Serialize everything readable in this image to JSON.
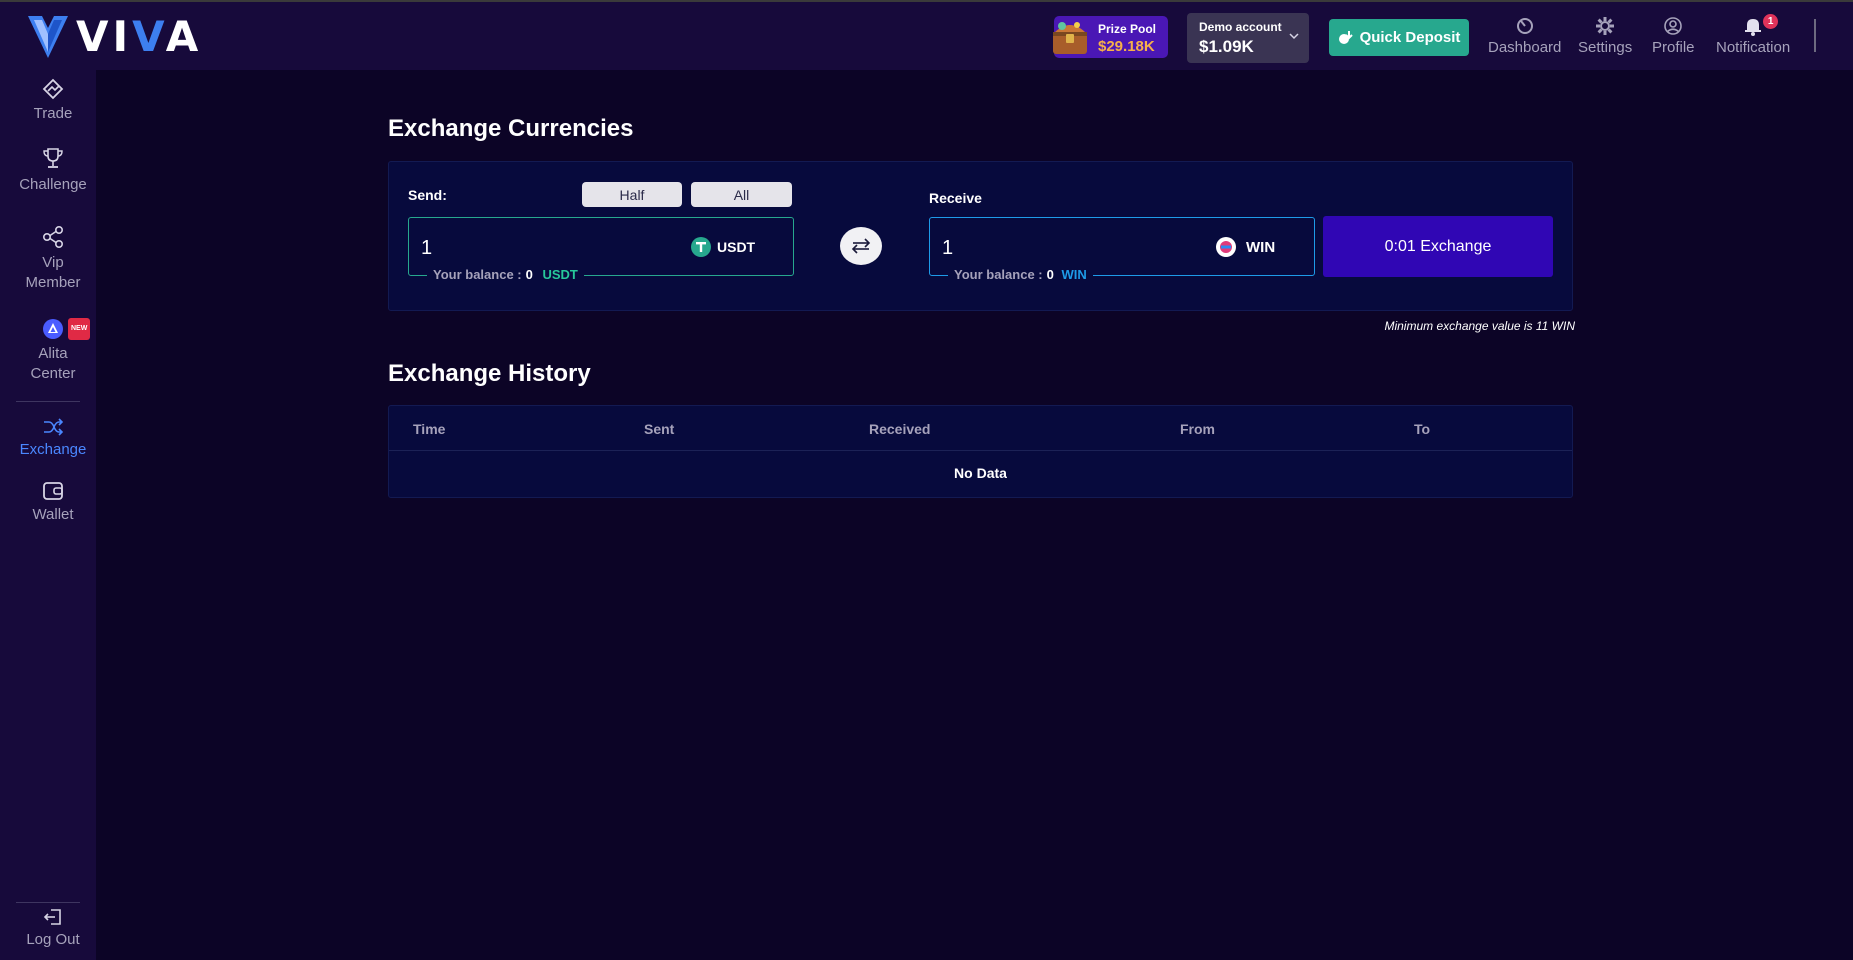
{
  "brand": {
    "name_prefix": "VI",
    "name_accent": "V",
    "name_suffix": "A"
  },
  "header": {
    "prize_pool": {
      "label": "Prize Pool",
      "value": "$29.18K"
    },
    "account": {
      "label": "Demo account",
      "balance": "$1.09K"
    },
    "quick_deposit": "Quick Deposit",
    "nav": [
      {
        "label": "Dashboard",
        "icon": "dashboard-icon"
      },
      {
        "label": "Settings",
        "icon": "gear-icon"
      },
      {
        "label": "Profile",
        "icon": "user-icon"
      },
      {
        "label": "Notification",
        "icon": "bell-icon",
        "badge": "1"
      }
    ]
  },
  "sidebar": {
    "items": [
      {
        "label": "Trade",
        "icon": "trade-icon"
      },
      {
        "label": "Challenge",
        "icon": "trophy-icon"
      },
      {
        "label": "Vip Member",
        "icon": "share-icon"
      },
      {
        "label": "Alita Center",
        "icon": "alita-icon",
        "tag": "NEW"
      },
      {
        "label": "Exchange",
        "icon": "shuffle-icon",
        "active": true
      },
      {
        "label": "Wallet",
        "icon": "wallet-icon"
      }
    ],
    "logout": "Log Out"
  },
  "exchange": {
    "title": "Exchange Currencies",
    "send": {
      "label": "Send:",
      "half": "Half",
      "all": "All",
      "value": "1",
      "currency": "USDT",
      "balance_label": "Your balance :",
      "balance_value": "0",
      "balance_currency": "USDT"
    },
    "receive": {
      "label": "Receive",
      "value": "1",
      "currency": "WIN",
      "balance_label": "Your balance :",
      "balance_value": "0",
      "balance_currency": "WIN"
    },
    "exchange_button": "0:01 Exchange",
    "min_note": "Minimum exchange value is 11 WIN",
    "colors": {
      "accent_green": "#27a88e",
      "accent_blue": "#3006b4",
      "win_blue": "#1e9be8"
    }
  },
  "history": {
    "title": "Exchange History",
    "columns": [
      "Time",
      "Sent",
      "Received",
      "From",
      "To"
    ],
    "empty_text": "No Data"
  }
}
